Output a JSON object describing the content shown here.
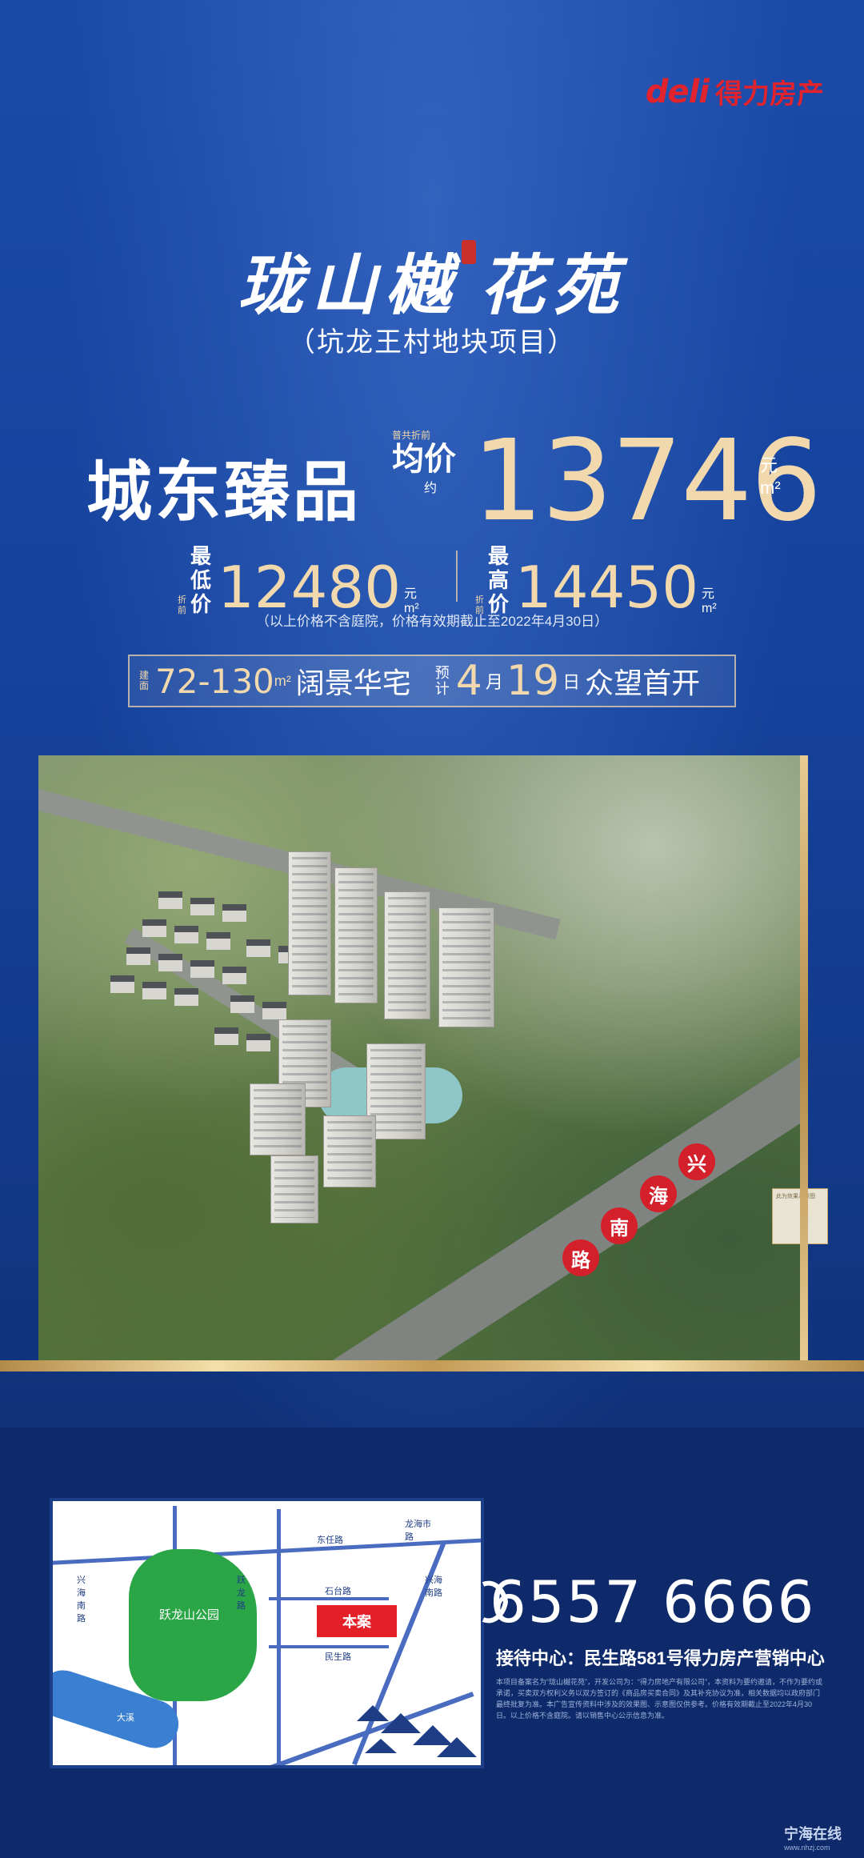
{
  "brand": {
    "mark": "deli",
    "name": "得力房产"
  },
  "project": {
    "title_a": "珑山樾",
    "title_b": "花苑",
    "subtitle": "（坑龙王村地块项目）"
  },
  "price": {
    "slogan": "城东臻品",
    "avg_note": "普共折前",
    "avg_label": "均价",
    "avg_approx": "约",
    "avg_value": "13746",
    "unit_yuan": "元",
    "unit_m2": "m²",
    "min_note": "折前",
    "min_label": "最低价",
    "min_value": "12480",
    "max_note": "折前",
    "max_label": "最高价",
    "max_value": "14450",
    "note": "（以上价格不含庭院，价格有效期截止至2022年4月30日）"
  },
  "banner": {
    "area_note": "建面",
    "area_value": "72-130",
    "area_unit": "m²",
    "area_text": "阔景华宅",
    "open_note": "预计",
    "month": "4",
    "month_label": "月",
    "day": "19",
    "day_label": "日",
    "open_text": "众望首开"
  },
  "render": {
    "road_chars": [
      "兴",
      "海",
      "南",
      "路"
    ],
    "tag_text": "此为效果示意图"
  },
  "map": {
    "park_name": "跃龙山公园",
    "site_label": "本案",
    "roads": [
      "东任路",
      "龙海市路",
      "兴海南路",
      "石台路",
      "跃龙路",
      "民生路",
      "兴海南路"
    ],
    "river": "大溪"
  },
  "contact": {
    "phone": "6557 6666",
    "reception": "接待中心：民生路581号得力房产营销中心",
    "disclaimer": "本项目备案名为“珑山樾花苑”，开发公司为：“得力房地产有限公司”，本资料为要约邀请，不作为要约或承诺，买卖双方权利义务以双方签订的《商品房买卖合同》及其补充协议为准，相关数据均以政府部门最终批复为准。本广告宣传资料中涉及的效果图、示意图仅供参考。价格有效期截止至2022年4月30日。以上价格不含庭院。请以销售中心公示信息为准。"
  },
  "watermark": {
    "name": "宁海在线",
    "url": "www.nhzj.com"
  }
}
